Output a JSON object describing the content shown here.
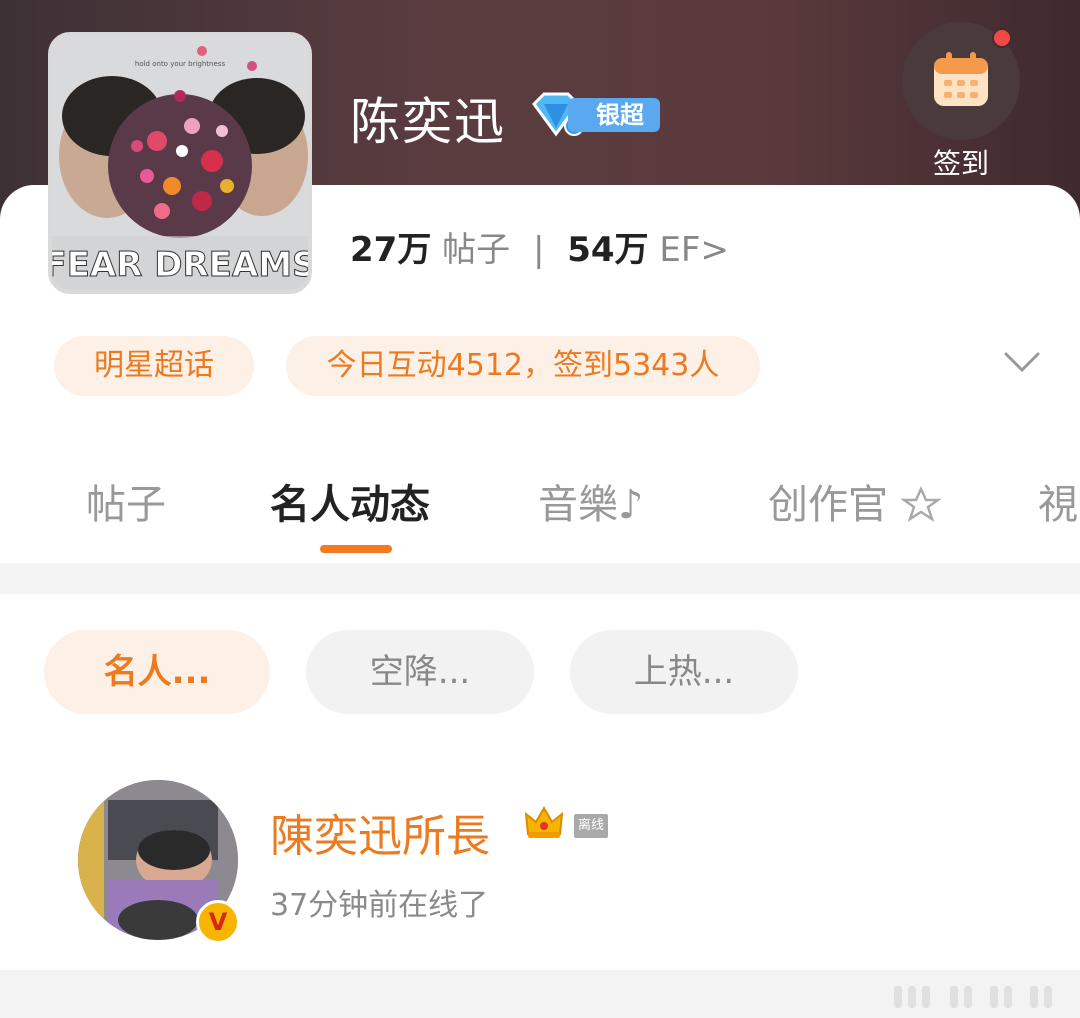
{
  "header": {
    "title": "陈奕迅",
    "badge_label": "银超",
    "signin_label": "签到"
  },
  "cover": {
    "poster_text_top": "hold onto your brightness",
    "poster_text_main": "FEAR  DREAMS"
  },
  "stats": {
    "posts_count": "27万",
    "posts_label": "帖子",
    "separator": "|",
    "fans_count": "54万",
    "fans_label": "EF>"
  },
  "chips": {
    "star_label": "明星超话",
    "activity_text": "今日互动4512，签到5343人"
  },
  "tabs": [
    {
      "label": "帖子"
    },
    {
      "label": "名人动态"
    },
    {
      "label": "音樂♪"
    },
    {
      "label": "创作官"
    },
    {
      "label": "視"
    }
  ],
  "filters": [
    {
      "label": "名人..."
    },
    {
      "label": "空降..."
    },
    {
      "label": "上热..."
    }
  ],
  "user": {
    "name": "陳奕迅所長",
    "status_tag": "离线",
    "last_seen": "37分钟前在线了",
    "verified_mark": "V"
  },
  "colors": {
    "accent": "#ec7a1f",
    "accent_bg": "#fdf0e6",
    "badge_blue": "#5aa9f0",
    "notify_red": "#f24848"
  },
  "icons": {
    "signin": "calendar-icon",
    "expand": "chevron-down-icon",
    "crown": "crown-icon",
    "badge": "diamond-icon"
  }
}
